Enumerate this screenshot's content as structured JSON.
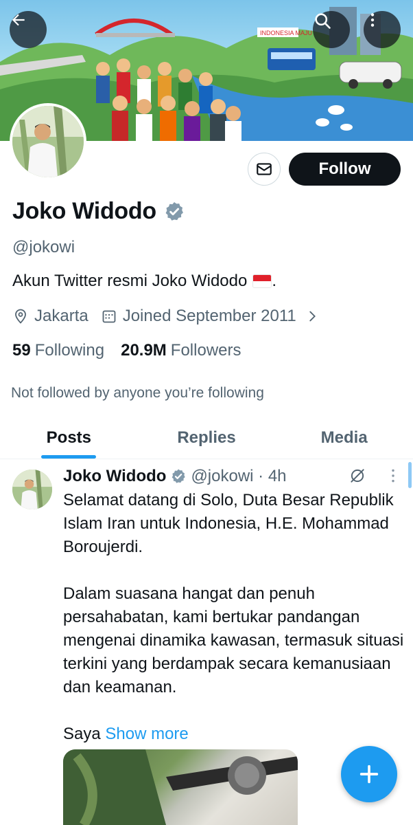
{
  "profile": {
    "name": "Joko Widodo",
    "handle": "@jokowi",
    "bio": "Akun Twitter resmi Joko Widodo",
    "location": "Jakarta",
    "joined": "Joined September 2011",
    "following_count": "59",
    "following_label": "Following",
    "followers_count": "20.9M",
    "followers_label": "Followers",
    "not_followed_text": "Not followed by anyone you’re following",
    "follow_button": "Follow",
    "banner_sign_text": "INDONESIA MAJU"
  },
  "tabs": [
    {
      "label": "Posts",
      "active": true
    },
    {
      "label": "Replies",
      "active": false
    },
    {
      "label": "Media",
      "active": false
    }
  ],
  "post": {
    "name": "Joko Widodo",
    "handle": "@jokowi",
    "separator": " · ",
    "time": "4h",
    "text_1": "Selamat datang di Solo, Duta Besar Republik Islam Iran untuk Indonesia, H.E. Mohammad Boroujerdi.",
    "text_2": "Dalam suasana hangat dan penuh persahabatan, kami bertukar pandangan mengenai dinamika kawasan, termasuk situasi terkini yang berdampak secara kemanusiaan dan keamanan.",
    "text_3": "Saya",
    "show_more": "Show more"
  },
  "colors": {
    "accent": "#1d9bf0",
    "text_primary": "#0f1419",
    "text_secondary": "#536471",
    "follow_bg": "#0f1419"
  },
  "icons": [
    "back-arrow-icon",
    "search-icon",
    "more-vertical-icon",
    "envelope-icon",
    "verified-badge-icon",
    "location-icon",
    "calendar-icon",
    "chevron-right-icon",
    "grok-icon",
    "plus-icon"
  ]
}
